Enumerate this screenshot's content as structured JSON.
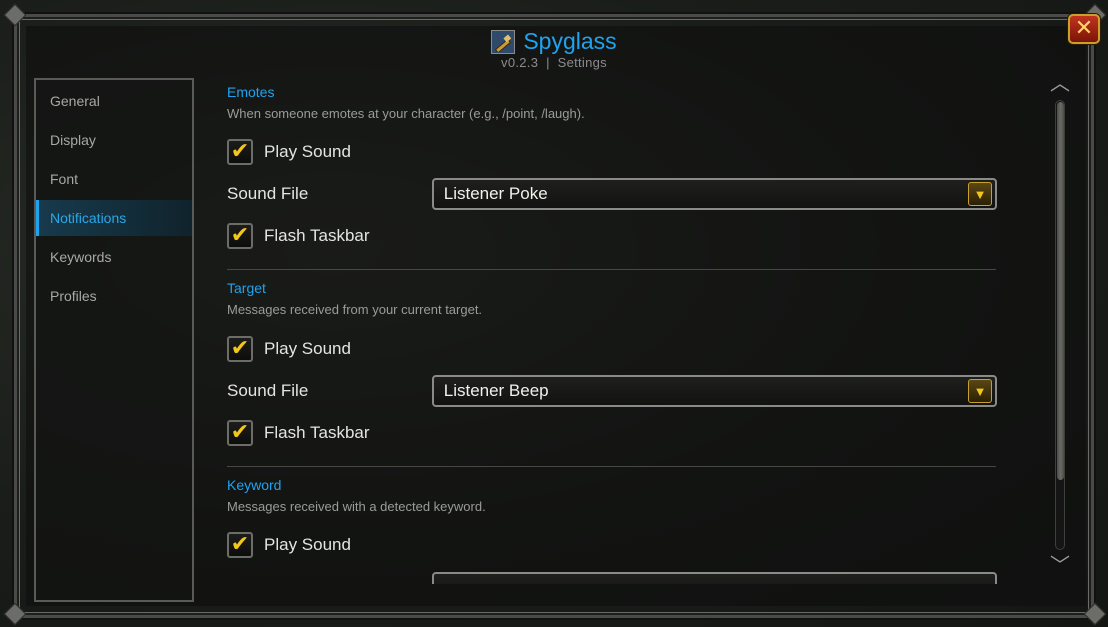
{
  "window": {
    "title": "Spyglass",
    "version": "v0.2.3",
    "separator": "|",
    "subtitle": "Settings",
    "close_label": "✕"
  },
  "sidebar": {
    "items": [
      {
        "label": "General",
        "active": false
      },
      {
        "label": "Display",
        "active": false
      },
      {
        "label": "Font",
        "active": false
      },
      {
        "label": "Notifications",
        "active": true
      },
      {
        "label": "Keywords",
        "active": false
      },
      {
        "label": "Profiles",
        "active": false
      }
    ]
  },
  "sections": [
    {
      "title": "Emotes",
      "description": "When someone emotes at your character (e.g., /point, /laugh).",
      "play_sound_label": "Play Sound",
      "play_sound_checked": true,
      "sound_file_label": "Sound File",
      "sound_file_value": "Listener Poke",
      "flash_label": "Flash Taskbar",
      "flash_checked": true
    },
    {
      "title": "Target",
      "description": "Messages received from your current target.",
      "play_sound_label": "Play Sound",
      "play_sound_checked": true,
      "sound_file_label": "Sound File",
      "sound_file_value": "Listener Beep",
      "flash_label": "Flash Taskbar",
      "flash_checked": true
    },
    {
      "title": "Keyword",
      "description": "Messages received with a detected keyword.",
      "play_sound_label": "Play Sound",
      "play_sound_checked": true
    }
  ],
  "icons": {
    "app": "spyglass-icon",
    "close": "close-icon",
    "checkmark": "checkmark-icon",
    "dropdown": "dropdown-arrow-icon",
    "scroll_up": "chevron-up-icon",
    "scroll_down": "chevron-down-icon"
  },
  "colors": {
    "accent": "#1fa3ef",
    "check": "#f2c71a",
    "close_bg": "#a82512"
  }
}
